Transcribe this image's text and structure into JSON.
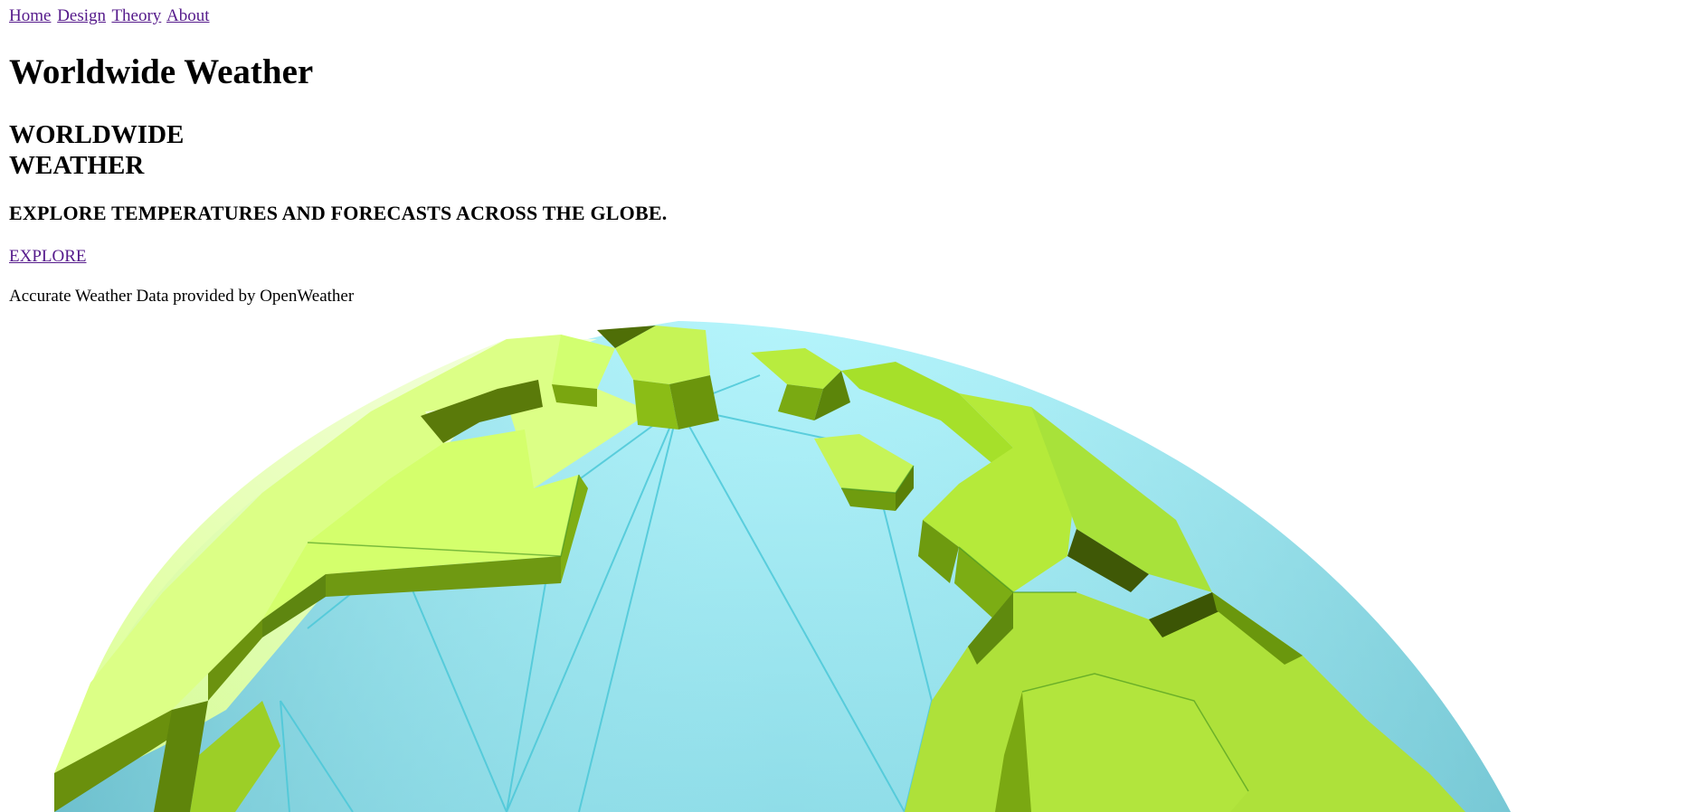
{
  "nav": {
    "items": [
      {
        "label": "Home"
      },
      {
        "label": "Design"
      },
      {
        "label": "Theory"
      },
      {
        "label": "About"
      }
    ]
  },
  "page_title": "Worldwide Weather",
  "hero": {
    "title_line1": "WORLDWIDE",
    "title_line2": "WEATHER",
    "subtitle": "EXPLORE TEMPERATURES AND FORECASTS ACROSS THE GLOBE.",
    "cta_label": "EXPLORE",
    "credit": "Accurate Weather Data provided by OpenWeather"
  },
  "colors": {
    "link": "#551a8b",
    "land_light": "#d7ff6f",
    "land_mid": "#a8dc2c",
    "land_dark": "#5f8a0e",
    "ocean_light": "#a6edf5",
    "ocean_dark": "#6cc2cf"
  },
  "illustration": {
    "name": "low-poly-globe-image"
  }
}
